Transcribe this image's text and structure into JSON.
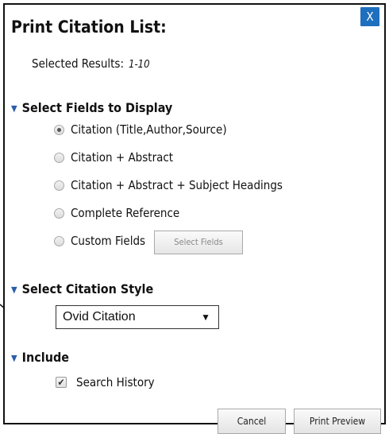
{
  "dialog": {
    "title": "Print Citation List:",
    "close_label": "X"
  },
  "selected_results": {
    "label": "Selected Results:",
    "value": "1-10"
  },
  "fields_section": {
    "heading": "Select Fields to Display",
    "options": [
      {
        "label": "Citation (Title,Author,Source)",
        "selected": true
      },
      {
        "label": "Citation + Abstract",
        "selected": false
      },
      {
        "label": "Citation + Abstract + Subject Headings",
        "selected": false
      },
      {
        "label": "Complete Reference",
        "selected": false
      },
      {
        "label": "Custom Fields",
        "selected": false
      }
    ],
    "select_fields_button": "Select Fields"
  },
  "style_section": {
    "heading": "Select Citation Style",
    "selected_style": "Ovid Citation"
  },
  "include_section": {
    "heading": "Include",
    "search_history_label": "Search History",
    "search_history_checked": true
  },
  "footer": {
    "cancel_label": "Cancel",
    "preview_label": "Print Preview"
  },
  "colors": {
    "close_bg": "#1f6fbf",
    "section_triangle": "#2a5ea8"
  }
}
